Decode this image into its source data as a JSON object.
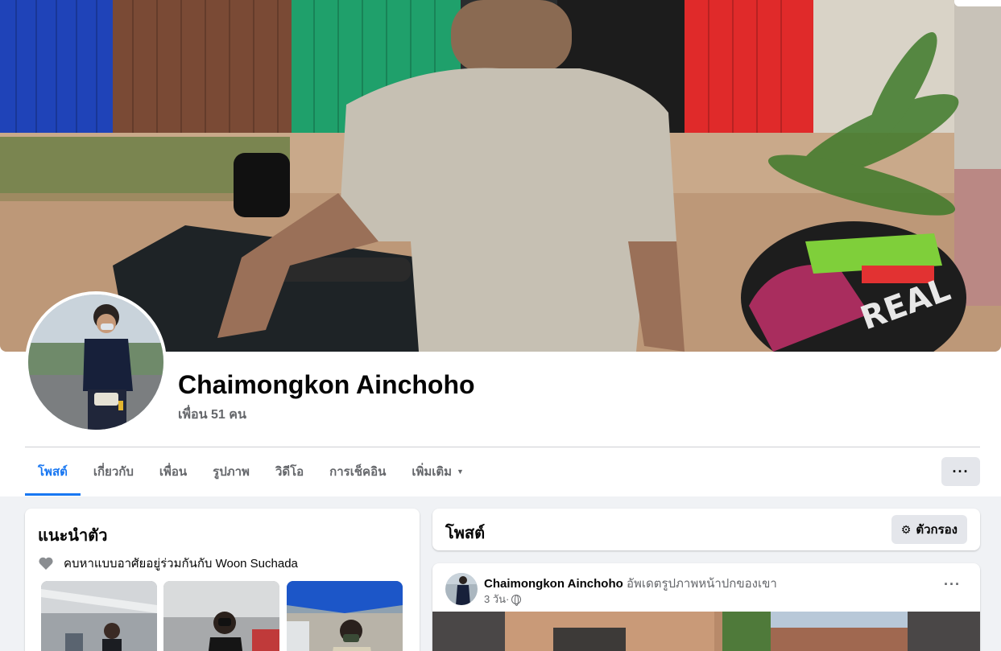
{
  "profile": {
    "name": "Chaimongkon Ainchoho",
    "friends": "เพื่อน 51 คน"
  },
  "tabs": [
    {
      "label": "โพสต์",
      "active": true
    },
    {
      "label": "เกี่ยวกับ",
      "active": false
    },
    {
      "label": "เพื่อน",
      "active": false
    },
    {
      "label": "รูปภาพ",
      "active": false
    },
    {
      "label": "วิดีโอ",
      "active": false
    },
    {
      "label": "การเช็คอิน",
      "active": false
    },
    {
      "label": "เพิ่มเติม",
      "active": false
    }
  ],
  "more_button": "···",
  "intro": {
    "title": "แนะนำตัว",
    "relationship": "คบหาแบบอาศัยอยู่ร่วมกันกับ Woon Suchada",
    "relationship_icon": "heart-icon"
  },
  "posts_header": {
    "title": "โพสต์",
    "filter_label": "ตัวกรอง",
    "filter_icon": "filter-icon"
  },
  "post": {
    "author": "Chaimongkon Ainchoho",
    "action": "อัพเดตรูปภาพหน้าปกของเขา",
    "time": "3 วัน",
    "separator": "·",
    "audience_icon": "globe-icon",
    "more": "···"
  },
  "colors": {
    "accent": "#1877f2",
    "page_bg": "#f0f2f5",
    "secondary_text": "#65676b",
    "button_bg": "#e4e6eb"
  }
}
